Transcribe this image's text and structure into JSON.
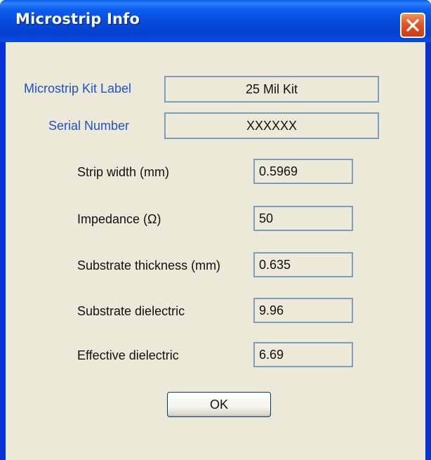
{
  "window": {
    "title": "Microstrip Info",
    "close_icon": "close-icon"
  },
  "kit": {
    "label_caption": "Microstrip Kit Label",
    "label_value": "25 Mil Kit",
    "serial_caption": "Serial Number",
    "serial_value": "XXXXXX"
  },
  "fields": [
    {
      "label": "Strip width (mm)",
      "value": "0.5969"
    },
    {
      "label": "Impedance (Ω)",
      "value": "50"
    },
    {
      "label": "Substrate thickness (mm)",
      "value": "0.635"
    },
    {
      "label": "Substrate dielectric",
      "value": "9.96"
    },
    {
      "label": "Effective dielectric",
      "value": "6.69"
    }
  ],
  "buttons": {
    "ok_label": "OK"
  },
  "colors": {
    "titlebar": "#0a5df0",
    "header_label": "#1f52c8",
    "close_button": "#e2542b",
    "dialog_bg": "#ece9d8"
  }
}
